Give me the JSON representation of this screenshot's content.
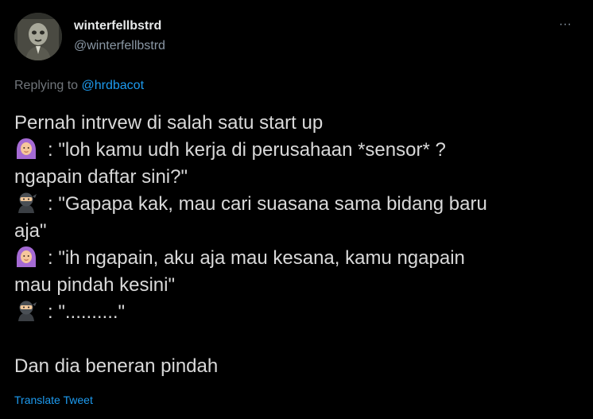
{
  "author": {
    "display_name": "winterfellbstrd",
    "handle": "@winterfellbstrd"
  },
  "more_icon": "more-horizontal-icon",
  "more_label": "···",
  "reply_context": {
    "prefix": "Replying to",
    "mention": "@hrdbacot"
  },
  "body": {
    "line1": "Pernah intrvew di salah satu start up",
    "line2": ": \"loh kamu udh kerja di perusahaan *sensor* ?",
    "line3": "ngapain daftar sini?\"",
    "line4": ": \"Gapapa kak, mau cari suasana sama bidang baru",
    "line5": "aja\"",
    "line6": ": \"ih ngapain, aku aja mau kesana, kamu ngapain",
    "line7": "mau pindah kesini\"",
    "line8": ": \"..........\"",
    "line9": "Dan dia beneran pindah"
  },
  "emoji_icons": [
    "woman-with-headscarf-emoji",
    "ninja-emoji"
  ],
  "translate_label": "Translate Tweet"
}
